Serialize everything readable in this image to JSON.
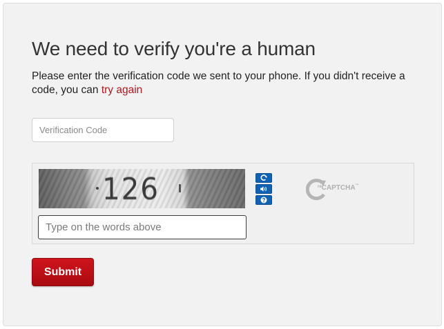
{
  "page": {
    "title": "We need to verify you're a human",
    "description_prefix": "Please enter the verification code we sent to your phone. If you didn't receive a code, you can ",
    "try_again_link": "try again"
  },
  "verification": {
    "placeholder": "Verification Code",
    "value": ""
  },
  "captcha": {
    "image_text": "126",
    "answer_placeholder": "Type on the words above",
    "answer_value": "",
    "logo_re": "re",
    "logo_text": "CAPTCHA",
    "logo_tm": "™",
    "icons": [
      "reload-icon",
      "audio-icon",
      "help-icon"
    ]
  },
  "submit_label": "Submit",
  "colors": {
    "accent": "#b8141b",
    "button": "#c00f17",
    "recaptcha_blue": "#0e61b3"
  }
}
